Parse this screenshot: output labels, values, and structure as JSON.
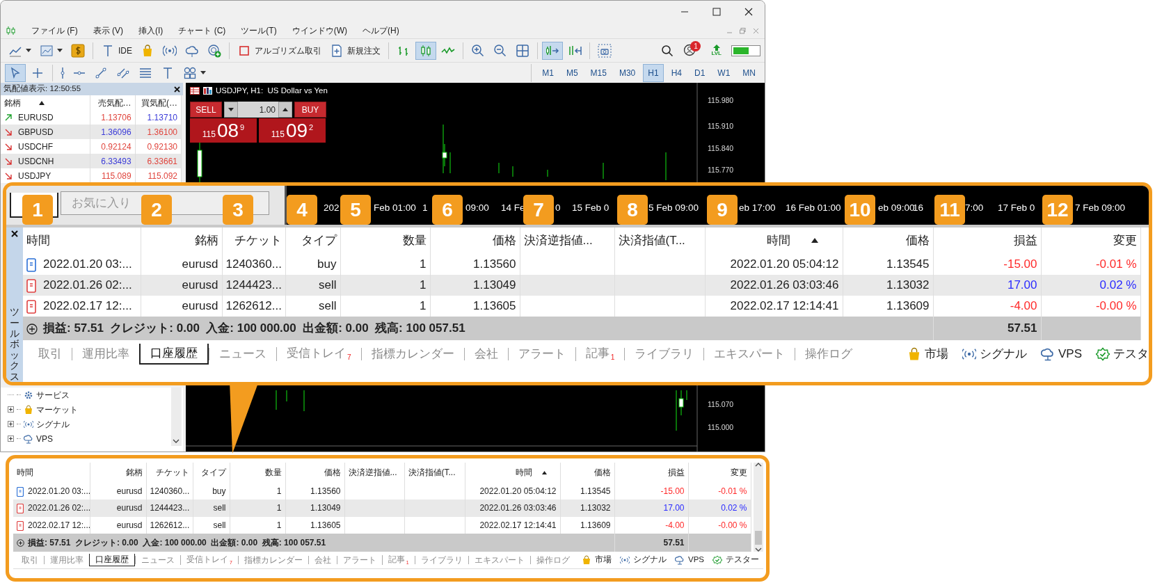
{
  "menu": [
    "ファイル (F)",
    "表示 (V)",
    "挿入(I)",
    "チャート (C)",
    "ツール(T)",
    "ウインドウ(W)",
    "ヘルプ(H)"
  ],
  "toolbar_main": [
    {
      "kind": "chart-type",
      "selected": false
    },
    {
      "kind": "template",
      "selected": false
    },
    {
      "kind": "dollar",
      "selected": false
    },
    {
      "kind": "text",
      "label": "IDE",
      "selected": false
    },
    {
      "kind": "bag",
      "selected": false
    },
    {
      "kind": "signal",
      "selected": false
    },
    {
      "kind": "cloud",
      "selected": false
    },
    {
      "kind": "globe",
      "selected": false
    },
    {
      "kind": "algo",
      "label": "アルゴリズム取引",
      "selected": false
    },
    {
      "kind": "order",
      "label": "新規注文",
      "selected": false
    },
    {
      "kind": "bars",
      "selected": false
    },
    {
      "kind": "candles",
      "selected": true
    },
    {
      "kind": "line",
      "selected": false
    },
    {
      "kind": "zoom-in",
      "selected": false
    },
    {
      "kind": "zoom-out",
      "selected": false
    },
    {
      "kind": "tile",
      "selected": false
    },
    {
      "kind": "autoscroll",
      "selected": true
    },
    {
      "kind": "shift",
      "selected": false
    },
    {
      "kind": "screenshot",
      "selected": false
    }
  ],
  "toolbar_status": {
    "notifications": "1",
    "level_label": "LVL"
  },
  "drawing_tools": [
    {
      "kind": "cursor",
      "selected": true
    },
    {
      "kind": "crosshair",
      "selected": false
    },
    {
      "kind": "vline",
      "selected": false
    },
    {
      "kind": "hline",
      "selected": false
    },
    {
      "kind": "trend",
      "selected": false
    },
    {
      "kind": "channel",
      "selected": false
    },
    {
      "kind": "fibo",
      "selected": false
    },
    {
      "kind": "text",
      "selected": false
    },
    {
      "kind": "shapes",
      "selected": false
    }
  ],
  "timeframes": [
    {
      "label": "M1",
      "selected": false
    },
    {
      "label": "M5",
      "selected": false
    },
    {
      "label": "M15",
      "selected": false
    },
    {
      "label": "M30",
      "selected": false
    },
    {
      "label": "H1",
      "selected": true
    },
    {
      "label": "H4",
      "selected": false
    },
    {
      "label": "D1",
      "selected": false
    },
    {
      "label": "W1",
      "selected": false
    },
    {
      "label": "MN",
      "selected": false
    }
  ],
  "market_watch": {
    "title": "気配値表示: 12:50:55",
    "columns": [
      {
        "label": "銘柄",
        "sorted": true
      },
      {
        "label": "売気配…",
        "sorted": false
      },
      {
        "label": "買気配(…",
        "sorted": false
      }
    ],
    "rows": [
      {
        "kind": "up",
        "symbol": "EURUSD",
        "bid": {
          "text": "1.13706",
          "color": "#e0443c"
        },
        "ask": {
          "text": "1.13710",
          "color": "#3b3bd8"
        }
      },
      {
        "kind": "down",
        "symbol": "GBPUSD",
        "bid": {
          "text": "1.36096",
          "color": "#3b3bd8"
        },
        "ask": {
          "text": "1.36100",
          "color": "#e0443c"
        }
      },
      {
        "kind": "down",
        "symbol": "USDCHF",
        "bid": {
          "text": "0.92124",
          "color": "#e0443c"
        },
        "ask": {
          "text": "0.92130",
          "color": "#e0443c"
        }
      },
      {
        "kind": "down",
        "symbol": "USDCNH",
        "bid": {
          "text": "6.33493",
          "color": "#3b3bd8"
        },
        "ask": {
          "text": "6.33661",
          "color": "#e0443c"
        }
      },
      {
        "kind": "down",
        "symbol": "USDJPY",
        "bid": {
          "text": "115.089",
          "color": "#e0443c"
        },
        "ask": {
          "text": "115.092",
          "color": "#e0443c"
        }
      }
    ]
  },
  "navigator": [
    {
      "label": "サービス",
      "kind": "services",
      "expandable": false
    },
    {
      "label": "マーケット",
      "kind": "market",
      "expandable": true
    },
    {
      "label": "シグナル",
      "kind": "signal",
      "expandable": true
    },
    {
      "label": "VPS",
      "kind": "vps",
      "expandable": true
    }
  ],
  "chart": {
    "title": "USDJPY, H1:  US Dollar vs Yen",
    "sell_label": "SELL",
    "buy_label": "BUY",
    "volume": "1.00",
    "sell_price": {
      "big_figure": "115",
      "pips": "08",
      "fraction": "9"
    },
    "buy_price": {
      "big_figure": "115",
      "pips": "09",
      "fraction": "2"
    },
    "price_labels": [
      "115.980",
      "115.910",
      "115.840",
      "115.770"
    ],
    "lower_price_labels": [
      "115.070",
      "115.000"
    ]
  },
  "magnified": {
    "favorites_tab": "お気に入り",
    "badges": [
      "1",
      "2",
      "3",
      "4",
      "5",
      "6",
      "7",
      "8",
      "9",
      "10",
      "11",
      "12"
    ],
    "axis_labels": [
      "202",
      "Feb 01:00",
      "1",
      "09:00",
      "14 Fe",
      "0",
      "15 Feb 0",
      "5 Feb 09:00",
      "eb 17:00",
      "16 Feb 01:00",
      "eb 09:00",
      "16",
      "7:00",
      "17 Feb 0",
      "7 Feb 09:00"
    ],
    "toolbox_title": "ツールボックス",
    "terminal": {
      "columns": [
        {
          "label": "時間",
          "sorted": false
        },
        {
          "label": "銘柄",
          "sorted": false
        },
        {
          "label": "チケット",
          "sorted": false
        },
        {
          "label": "タイプ",
          "sorted": false
        },
        {
          "label": "数量",
          "sorted": false
        },
        {
          "label": "価格",
          "sorted": false
        },
        {
          "label": "決済逆指値...",
          "sorted": false
        },
        {
          "label": "決済指値(T...",
          "sorted": false
        },
        {
          "label": "時間",
          "sorted": true
        },
        {
          "label": "価格",
          "sorted": false
        },
        {
          "label": "損益",
          "sorted": false
        },
        {
          "label": "変更",
          "sorted": false
        }
      ],
      "rows": [
        {
          "kind": "buy",
          "time": "2022.01.20 03:...",
          "symbol": "eurusd",
          "ticket": "1240360...",
          "type": "buy",
          "volume": "1",
          "price": "1.13560",
          "close_time": "2022.01.20 05:04:12",
          "close_price": "1.13545",
          "profit": "-15.00",
          "change": "-0.01 %",
          "color": "#ff2a2a"
        },
        {
          "kind": "sell",
          "time": "2022.01.26 02:...",
          "symbol": "eurusd",
          "ticket": "1244423...",
          "type": "sell",
          "volume": "1",
          "price": "1.13049",
          "close_time": "2022.01.26 03:03:46",
          "close_price": "1.13032",
          "profit": "17.00",
          "change": "0.02 %",
          "color": "#2a2aff"
        },
        {
          "kind": "sell",
          "time": "2022.02.17 12:...",
          "symbol": "eurusd",
          "ticket": "1262612...",
          "type": "sell",
          "volume": "1",
          "price": "1.13605",
          "close_time": "2022.02.17 12:14:41",
          "close_price": "1.13609",
          "profit": "-4.00",
          "change": "-0.00 %",
          "color": "#ff2a2a"
        }
      ],
      "summary": {
        "text": "損益: 57.51  クレジット: 0.00  入金: 100 000.00  出金額: 0.00  残高: 100 057.51",
        "total": "57.51"
      },
      "tabs": [
        {
          "label": "取引",
          "selected": false
        },
        {
          "label": "運用比率",
          "selected": false
        },
        {
          "label": "口座履歴",
          "selected": true
        },
        {
          "label": "ニュース",
          "selected": false
        },
        {
          "label": "受信トレイ",
          "count": "7",
          "selected": false
        },
        {
          "label": "指標カレンダー",
          "selected": false
        },
        {
          "label": "会社",
          "selected": false
        },
        {
          "label": "アラート",
          "selected": false
        },
        {
          "label": "記事",
          "count": "1",
          "selected": false
        },
        {
          "label": "ライブラリ",
          "selected": false
        },
        {
          "label": "エキスパート",
          "selected": false
        },
        {
          "label": "操作ログ",
          "selected": false
        }
      ],
      "side_tabs": [
        {
          "kind": "market",
          "label": "市場"
        },
        {
          "kind": "signal",
          "label": "シグナル"
        },
        {
          "kind": "vps",
          "label": "VPS"
        },
        {
          "kind": "tester",
          "label": "テスタ"
        }
      ]
    }
  },
  "terminal": {
    "columns": [
      {
        "label": "時間",
        "sorted": false
      },
      {
        "label": "銘柄",
        "sorted": false
      },
      {
        "label": "チケット",
        "sorted": false
      },
      {
        "label": "タイプ",
        "sorted": false
      },
      {
        "label": "数量",
        "sorted": false
      },
      {
        "label": "価格",
        "sorted": false
      },
      {
        "label": "決済逆指値...",
        "sorted": false
      },
      {
        "label": "決済指値(T...",
        "sorted": false
      },
      {
        "label": "時間",
        "sorted": true
      },
      {
        "label": "価格",
        "sorted": false
      },
      {
        "label": "損益",
        "sorted": false
      },
      {
        "label": "変更",
        "sorted": false
      }
    ],
    "rows": [
      {
        "kind": "buy",
        "time": "2022.01.20 03:...",
        "symbol": "eurusd",
        "ticket": "1240360...",
        "type": "buy",
        "volume": "1",
        "price": "1.13560",
        "close_time": "2022.01.20 05:04:12",
        "close_price": "1.13545",
        "profit": "-15.00",
        "change": "-0.01 %",
        "color": "#ff2a2a"
      },
      {
        "kind": "sell",
        "time": "2022.01.26 02:...",
        "symbol": "eurusd",
        "ticket": "1244423...",
        "type": "sell",
        "volume": "1",
        "price": "1.13049",
        "close_time": "2022.01.26 03:03:46",
        "close_price": "1.13032",
        "profit": "17.00",
        "change": "0.02 %",
        "color": "#2a2aff"
      },
      {
        "kind": "sell",
        "time": "2022.02.17 12:...",
        "symbol": "eurusd",
        "ticket": "1262612...",
        "type": "sell",
        "volume": "1",
        "price": "1.13605",
        "close_time": "2022.02.17 12:14:41",
        "close_price": "1.13609",
        "profit": "-4.00",
        "change": "-0.00 %",
        "color": "#ff2a2a"
      }
    ],
    "summary": {
      "text": "損益: 57.51  クレジット: 0.00  入金: 100 000.00  出金額: 0.00  残高: 100 057.51",
      "total": "57.51"
    },
    "tabs": [
      {
        "label": "取引",
        "selected": false
      },
      {
        "label": "運用比率",
        "selected": false
      },
      {
        "label": "口座履歴",
        "selected": true
      },
      {
        "label": "ニュース",
        "selected": false
      },
      {
        "label": "受信トレイ",
        "count": "7",
        "selected": false
      },
      {
        "label": "指標カレンダー",
        "selected": false
      },
      {
        "label": "会社",
        "selected": false
      },
      {
        "label": "アラート",
        "selected": false
      },
      {
        "label": "記事",
        "count": "1",
        "selected": false
      },
      {
        "label": "ライブラリ",
        "selected": false
      },
      {
        "label": "エキスパート",
        "selected": false
      },
      {
        "label": "操作ログ",
        "selected": false
      }
    ],
    "side_tabs": [
      {
        "kind": "market",
        "label": "市場"
      },
      {
        "kind": "signal",
        "label": "シグナル"
      },
      {
        "kind": "vps",
        "label": "VPS"
      },
      {
        "kind": "tester",
        "label": "テスター"
      }
    ]
  }
}
